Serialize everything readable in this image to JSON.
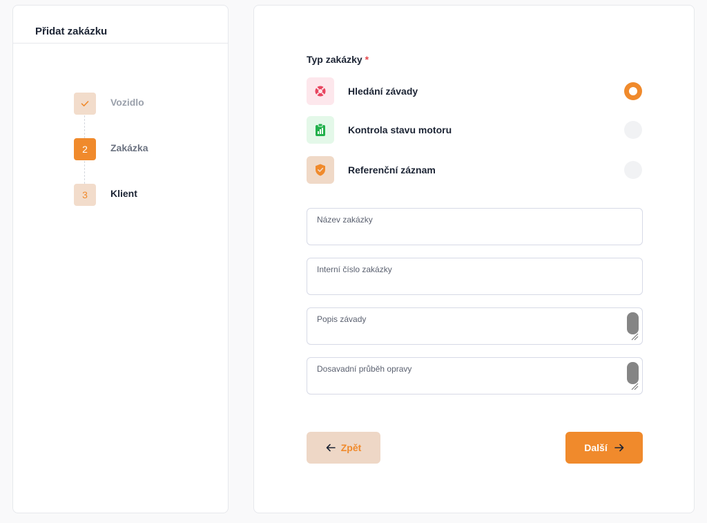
{
  "sidebar": {
    "title": "Přidat zakázku",
    "steps": [
      {
        "number": "",
        "label": "Vozidlo",
        "state": "done",
        "icon": "check-icon"
      },
      {
        "number": "2",
        "label": "Zakázka",
        "state": "active"
      },
      {
        "number": "3",
        "label": "Klient",
        "state": "pending"
      }
    ]
  },
  "form": {
    "type_label": "Typ zakázky",
    "required_mark": "*",
    "options": [
      {
        "label": "Hledání závady",
        "icon": "lifebuoy-icon",
        "selected": true
      },
      {
        "label": "Kontrola stavu motoru",
        "icon": "clipboard-chart-icon",
        "selected": false
      },
      {
        "label": "Referenční záznam",
        "icon": "shield-check-icon",
        "selected": false
      }
    ],
    "fields": {
      "name": {
        "label": "Název zakázky",
        "value": ""
      },
      "internal_number": {
        "label": "Interní číslo zakázky",
        "value": ""
      },
      "fault_description": {
        "label": "Popis závady",
        "value": ""
      },
      "repair_history": {
        "label": "Dosavadní průběh opravy",
        "value": ""
      }
    },
    "buttons": {
      "back": "Zpět",
      "next": "Další"
    }
  },
  "colors": {
    "accent": "#f08a2c",
    "accent_light": "#f2dccb",
    "required": "#e5484d"
  }
}
